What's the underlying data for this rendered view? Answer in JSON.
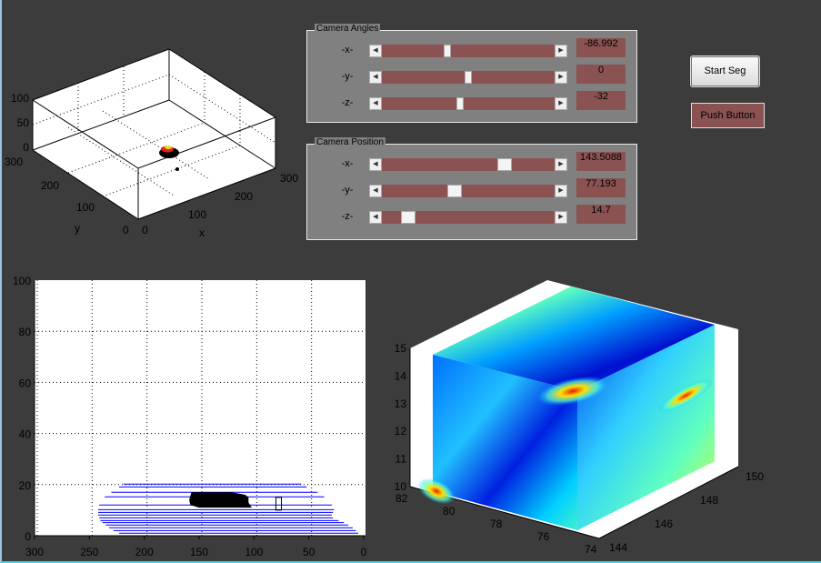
{
  "camera_angles": {
    "title": "Camera Angles",
    "rows": [
      {
        "label": "-x-",
        "value": "-86.992",
        "slider_fraction": 0.38
      },
      {
        "label": "-y-",
        "value": "0",
        "slider_fraction": 0.5
      },
      {
        "label": "-z-",
        "value": "-32",
        "slider_fraction": 0.45
      }
    ]
  },
  "camera_position": {
    "title": "Camera Position",
    "rows": [
      {
        "label": "-x-",
        "value": "143.5088",
        "slider_fraction": 0.71
      },
      {
        "label": "-y-",
        "value": "77.193",
        "slider_fraction": 0.42
      },
      {
        "label": "-z-",
        "value": "14.7",
        "slider_fraction": 0.15
      }
    ]
  },
  "buttons": {
    "start_seg": "Start Seg",
    "push_button": "Push Button"
  },
  "colors": {
    "slider_track": "#8b5252",
    "panel": "#808080",
    "background": "#3c3c3c",
    "line": "#0000ff"
  },
  "plot3d_top": {
    "xlabel": "x",
    "ylabel": "y",
    "xticks": [
      "0",
      "100",
      "200",
      "300"
    ],
    "yticks": [
      "0",
      "100",
      "200",
      "300"
    ],
    "zticks": [
      "0",
      "50",
      "100"
    ]
  },
  "chart_data": [
    {
      "type": "line",
      "title": "",
      "xlabel": "",
      "ylabel": "",
      "xlim": [
        300,
        0
      ],
      "x_reversed": true,
      "ylim": [
        0,
        100
      ],
      "grid": true,
      "xticks": [
        "300",
        "250",
        "200",
        "150",
        "100",
        "50",
        "0"
      ],
      "yticks": [
        "0",
        "20",
        "40",
        "60",
        "80",
        "100"
      ],
      "series": [
        {
          "segments": [
            {
              "y": 20.2,
              "x": [
                219,
                57
              ]
            },
            {
              "y": 19.1,
              "x": [
                223,
                52
              ]
            },
            {
              "y": 17,
              "x": [
                230,
                42
              ]
            },
            {
              "y": 15.2,
              "x": [
                236,
                36
              ]
            },
            {
              "y": 12,
              "x": [
                241,
                29
              ]
            },
            {
              "y": 10.2,
              "x": [
                242,
                27
              ]
            },
            {
              "y": 9.1,
              "x": [
                242,
                28
              ]
            },
            {
              "y": 8.1,
              "x": [
                242,
                29
              ]
            },
            {
              "y": 7,
              "x": [
                241,
                28
              ]
            },
            {
              "y": 5.9,
              "x": [
                240,
                23
              ]
            },
            {
              "y": 5.1,
              "x": [
                238,
                18
              ]
            },
            {
              "y": 4.2,
              "x": [
                235,
                14
              ]
            },
            {
              "y": 3.1,
              "x": [
                232,
                10
              ]
            },
            {
              "y": 2,
              "x": [
                228,
                7
              ]
            },
            {
              "y": 1,
              "x": [
                223,
                5
              ]
            }
          ]
        }
      ],
      "blob": [
        [
          157,
          17
        ],
        [
          120,
          17
        ],
        [
          108,
          16
        ],
        [
          105,
          15
        ],
        [
          105,
          13
        ],
        [
          102,
          11
        ],
        [
          150,
          11
        ],
        [
          158,
          12
        ],
        [
          159,
          14
        ]
      ],
      "marker_box": {
        "x": [
          80,
          75
        ],
        "y": [
          10,
          15
        ]
      }
    },
    {
      "type": "surface",
      "zticks": [
        "10",
        "11",
        "12",
        "13",
        "14",
        "15"
      ],
      "xticks": [
        "82",
        "80",
        "78",
        "76",
        "74"
      ],
      "yticks": [
        "144",
        "146",
        "148",
        "150"
      ]
    }
  ]
}
